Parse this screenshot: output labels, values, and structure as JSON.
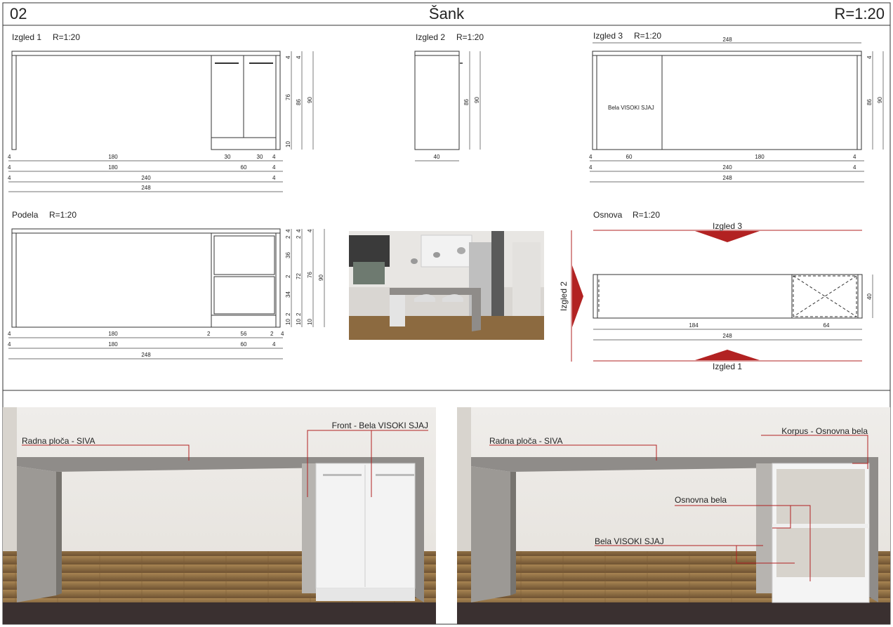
{
  "header": {
    "number": "02",
    "title": "Šank",
    "scale": "R=1:20"
  },
  "views": {
    "izgled1": {
      "title": "Izgled 1",
      "scale": "R=1:20",
      "dims": {
        "w180": "180",
        "w30a": "30",
        "w30b": "30",
        "w4": "4",
        "w60": "60",
        "w240": "240",
        "w248": "248",
        "h4": "4",
        "h76": "76",
        "h10": "10",
        "h86": "86",
        "h90": "90"
      }
    },
    "izgled2": {
      "title": "Izgled 2",
      "scale": "R=1:20",
      "dims": {
        "w40": "40",
        "h86": "86",
        "h90": "90"
      }
    },
    "izgled3": {
      "title": "Izgled 3",
      "scale": "R=1:20",
      "panel_label": "Bela VISOKI SJAJ",
      "dims": {
        "w248": "248",
        "w60": "60",
        "w180": "180",
        "w4": "4",
        "w240": "240",
        "h4": "4",
        "h86": "86",
        "h90": "90"
      }
    },
    "podela": {
      "title": "Podela",
      "scale": "R=1:20",
      "dims": {
        "w180": "180",
        "w2": "2",
        "w56": "56",
        "w4": "4",
        "w60": "60",
        "w248": "248",
        "h4": "4",
        "h2": "2",
        "h36": "36",
        "h34": "34",
        "h10": "10",
        "h72": "72",
        "h76": "76",
        "h90": "90"
      }
    },
    "osnova": {
      "title": "Osnova",
      "scale": "R=1:20",
      "arrows": {
        "top": "Izgled 3",
        "left": "Izgled 2",
        "bottom": "Izgled 1"
      },
      "dims": {
        "w184": "184",
        "w64": "64",
        "w248": "248",
        "h40": "40"
      }
    }
  },
  "render_left": {
    "labels": {
      "worktop": "Radna ploča - SIVA",
      "front": "Front - Bela VISOKI SJAJ"
    }
  },
  "render_right": {
    "labels": {
      "worktop": "Radna ploča - SIVA",
      "korpus": "Korpus - Osnovna bela",
      "shelf": "Osnovna bela",
      "gloss": "Bela VISOKI SJAJ"
    }
  },
  "colors": {
    "accent_red": "#b22222",
    "worktop": "#8f8c89",
    "wall": "#e9e6e1",
    "floor": "#8a6a45"
  }
}
